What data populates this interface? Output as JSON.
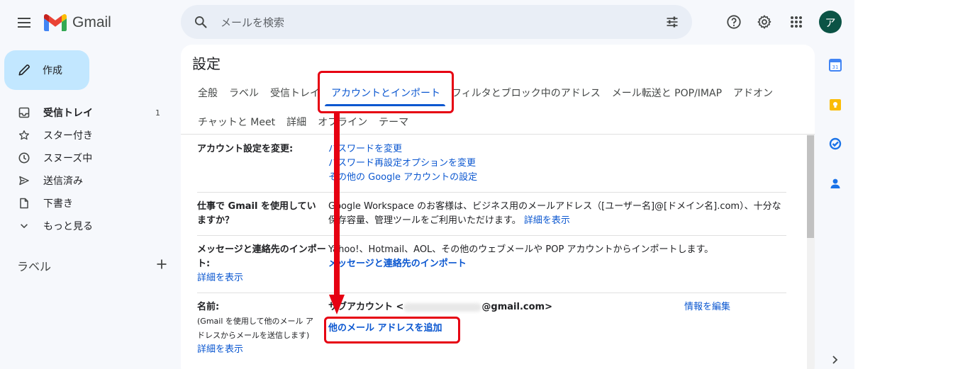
{
  "header": {
    "app_name": "Gmail",
    "search_placeholder": "メールを検索",
    "avatar_letter": "ア"
  },
  "compose": {
    "label": "作成"
  },
  "nav": {
    "items": [
      {
        "label": "受信トレイ",
        "count": "1",
        "icon": "inbox-icon"
      },
      {
        "label": "スター付き",
        "icon": "star-icon"
      },
      {
        "label": "スヌーズ中",
        "icon": "clock-icon"
      },
      {
        "label": "送信済み",
        "icon": "send-icon"
      },
      {
        "label": "下書き",
        "icon": "draft-icon"
      },
      {
        "label": "もっと見る",
        "icon": "chevron-down-icon"
      }
    ],
    "labels_heading": "ラベル"
  },
  "settings": {
    "title": "設定",
    "tabs_row1": [
      "全般",
      "ラベル",
      "受信トレイ",
      "アカウントとインポート",
      "フィルタとブロック中のアドレス",
      "メール転送と POP/IMAP",
      "アドオン"
    ],
    "tabs_row2": [
      "チャットと Meet",
      "詳細",
      "オフライン",
      "テーマ"
    ],
    "active_tab": "アカウントとインポート",
    "rows": {
      "account": {
        "label": "アカウント設定を変更:",
        "links": [
          "パスワードを変更",
          "パスワード再設定オプションを変更",
          "その他の Google アカウントの設定"
        ]
      },
      "work": {
        "label": "仕事で Gmail を使用していますか？",
        "text": "Google Workspace のお客様は、ビジネス用のメールアドレス（[ユーザー名]@[ドメイン名].com）、十分な保存容量、管理ツールをご利用いただけます。",
        "link": "詳細を表示"
      },
      "import": {
        "label": "メッセージと連絡先のインポート:",
        "text": "Yahoo!、Hotmail、AOL、その他のウェブメールや POP アカウントからインポートします。",
        "link": "メッセージと連絡先のインポート",
        "more": "詳細を表示"
      },
      "name": {
        "label": "名前:",
        "sublabel": "(Gmail を使用して他のメール アドレスからメールを送信します)",
        "more": "詳細を表示",
        "account_prefix": "サブアカウント <",
        "account_suffix": "@gmail.com>",
        "edit_link": "情報を編集",
        "add_link": "他のメール アドレスを追加"
      }
    }
  },
  "colors": {
    "accent": "#0b57d0",
    "annotation": "#e60012",
    "compose_bg": "#c2e7ff"
  }
}
